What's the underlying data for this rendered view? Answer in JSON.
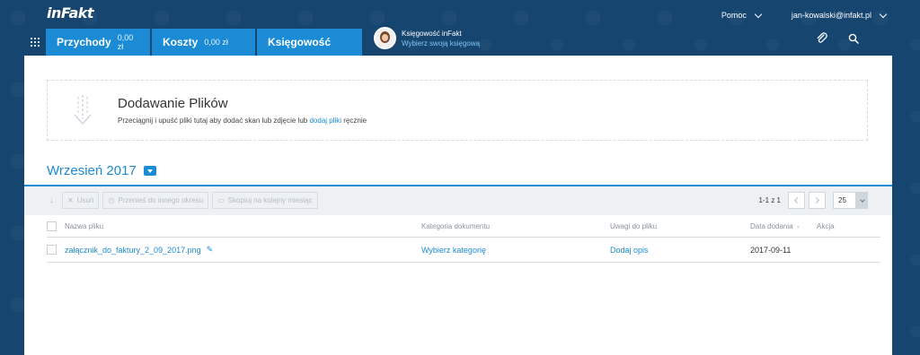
{
  "app": {
    "logo": "inFakt"
  },
  "topbar": {
    "help_label": "Pomoc",
    "user_email": "jan-kowalski@infakt.pl"
  },
  "nav": {
    "tabs": [
      {
        "label": "Przychody",
        "amount": "0,00 zł"
      },
      {
        "label": "Koszty",
        "amount": "0,00 zł"
      },
      {
        "label": "Księgowość",
        "amount": ""
      }
    ],
    "accountant": {
      "name": "Księgowość inFakt",
      "action": "Wybierz swoją księgową"
    }
  },
  "upload": {
    "title": "Dodawanie Plików",
    "desc_before": "Przeciągnij i upuść pliki tutaj aby dodać skan lub zdjęcie lub",
    "desc_link": "dodaj pliki",
    "desc_after": "ręcznie"
  },
  "period": {
    "title": "Wrzesień 2017"
  },
  "toolbar": {
    "delete_label": "Usuń",
    "move_label": "Przenieś do innego okresu",
    "copy_label": "Skopiuj na kolejny miesiąc",
    "pager_text": "1-1 z 1",
    "per_page": "25"
  },
  "table": {
    "headers": {
      "name": "Nazwa pliku",
      "category": "Kategoria dokumentu",
      "notes": "Uwagi do pliku",
      "date": "Data dodania",
      "action": "Akcja"
    },
    "rows": [
      {
        "name": "załącznik_do_faktury_2_09_2017.png",
        "category": "Wybierz kategorię",
        "notes": "Dodaj opis",
        "date": "2017-09-11"
      }
    ]
  },
  "colors": {
    "brand_dark": "#16456f",
    "accent": "#1b8bd6"
  }
}
